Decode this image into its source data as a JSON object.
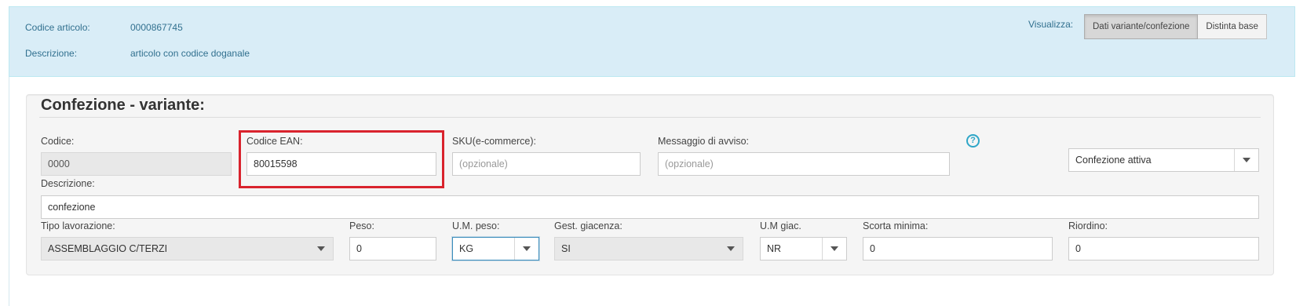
{
  "header": {
    "codice_label": "Codice articolo:",
    "codice_value": "0000867745",
    "descrizione_label": "Descrizione:",
    "descrizione_value": "articolo con codice doganale",
    "visualizza_label": "Visualizza:",
    "view_buttons": [
      {
        "label": "Dati variante/confezione",
        "active": true
      },
      {
        "label": "Distinta base",
        "active": false
      }
    ]
  },
  "section": {
    "title": "Confezione - variante:",
    "codice": {
      "label": "Codice:",
      "value": "0000"
    },
    "codice_ean": {
      "label": "Codice EAN:",
      "value": "80015598"
    },
    "sku": {
      "label": "SKU(e-commerce):",
      "placeholder": "(opzionale)"
    },
    "messaggio": {
      "label": "Messaggio di avviso:",
      "placeholder": "(opzionale)"
    },
    "help_icon": "?",
    "stato": {
      "value": "Confezione attiva"
    },
    "descrizione": {
      "label": "Descrizione:",
      "value": "confezione"
    },
    "tipo_lavorazione": {
      "label": "Tipo lavorazione:",
      "value": "ASSEMBLAGGIO C/TERZI"
    },
    "peso": {
      "label": "Peso:",
      "value": "0"
    },
    "um_peso": {
      "label": "U.M. peso:",
      "value": "KG"
    },
    "gest_giacenza": {
      "label": "Gest. giacenza:",
      "value": "SI"
    },
    "um_giac": {
      "label": "U.M giac.",
      "value": "NR"
    },
    "scorta_minima": {
      "label": "Scorta minima:",
      "value": "0"
    },
    "riordino": {
      "label": "Riordino:",
      "value": "0"
    }
  },
  "colors": {
    "header_bg": "#d9edf7",
    "header_text": "#31708f",
    "highlight": "#d9232d",
    "help_icon": "#2fa6c7"
  },
  "icons": {
    "help": "question-circle-icon",
    "dropdown": "caret-down-icon"
  }
}
